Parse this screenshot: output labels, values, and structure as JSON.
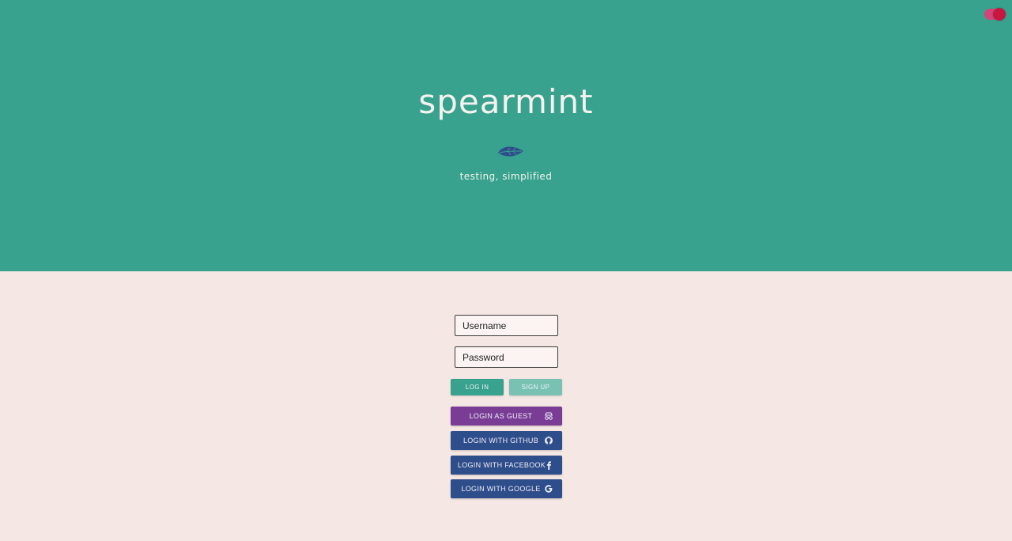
{
  "header": {
    "title": "spearmint",
    "tagline": "testing, simplified"
  },
  "theme_toggle": {
    "state": "on",
    "color": "#c8163f"
  },
  "form": {
    "username_placeholder": "Username",
    "password_placeholder": "Password",
    "login_label": "LOG IN",
    "signup_label": "SIGN UP"
  },
  "social": {
    "guest_label": "LOGIN AS GUEST",
    "github_label": "LOGIN WITH GITHUB",
    "facebook_label": "LOGIN WITH FACEBOOK",
    "google_label": "LOGIN WITH GOOGLE",
    "guest_icon": "incognito-icon",
    "github_icon": "github-icon",
    "facebook_icon": "facebook-icon",
    "google_icon": "google-icon"
  },
  "colors": {
    "hero_background": "#38a28f",
    "page_background": "#f5e7e4",
    "guest_button": "#7a3d96",
    "oauth_button": "#2e4d8b",
    "login_button": "#38a28f",
    "signup_button": "#78c1b3"
  }
}
